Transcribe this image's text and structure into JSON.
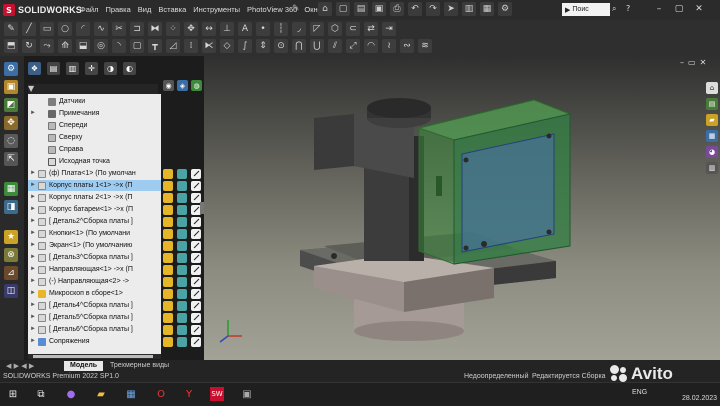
{
  "app": {
    "logo_text": "SOLIDWORKS",
    "logo_letter": "S"
  },
  "menu": [
    "Файл",
    "Правка",
    "Вид",
    "Вставка",
    "Инструменты",
    "PhotoView 360",
    "Окно"
  ],
  "search": {
    "value": "Поис"
  },
  "tree": [
    {
      "label": "Датчики",
      "icon": "sensor-icon",
      "expander": ""
    },
    {
      "label": "Примечания",
      "icon": "annotations-icon",
      "expander": "►"
    },
    {
      "label": "Спереди",
      "icon": "plane-icon",
      "expander": ""
    },
    {
      "label": "Сверху",
      "icon": "plane-icon",
      "expander": ""
    },
    {
      "label": "Справа",
      "icon": "plane-icon",
      "expander": ""
    },
    {
      "label": "Исходная точка",
      "icon": "origin-icon",
      "expander": ""
    },
    {
      "label": "(ф) Плата<1> (По умолчан",
      "icon": "part-icon",
      "expander": "►"
    },
    {
      "label": "Корпус платы 1<1> ->x (П",
      "icon": "part-icon",
      "expander": "►",
      "selected": true
    },
    {
      "label": "Корпус платы 2<1> ->x (П",
      "icon": "part-icon",
      "expander": "►"
    },
    {
      "label": "Корпус батареи<1> ->x (П",
      "icon": "part-icon",
      "expander": "►"
    },
    {
      "label": "[ Деталь2^Сборка платы ]",
      "icon": "part-icon",
      "expander": "►"
    },
    {
      "label": "Кнопки<1> (По умолчани",
      "icon": "part-icon",
      "expander": "►"
    },
    {
      "label": "Экран<1> (По умолчанию",
      "icon": "part-icon",
      "expander": "►"
    },
    {
      "label": "[ Деталь3^Сборка платы ]",
      "icon": "part-icon",
      "expander": "►"
    },
    {
      "label": "Направляющая<1> ->x (П",
      "icon": "part-icon",
      "expander": "►"
    },
    {
      "label": "(-) Направляющая<2> ->",
      "icon": "part-icon",
      "expander": "►"
    },
    {
      "label": "Микроскоп в сборе<1>",
      "icon": "assembly-icon",
      "expander": "►"
    },
    {
      "label": "[ Деталь4^Сборка платы ]",
      "icon": "part-icon",
      "expander": "►"
    },
    {
      "label": "[ Деталь5^Сборка платы ]",
      "icon": "part-icon",
      "expander": "►"
    },
    {
      "label": "[ Деталь6^Сборка платы ]",
      "icon": "part-icon",
      "expander": "►"
    },
    {
      "label": "Сопряжения",
      "icon": "mates-icon",
      "expander": "►"
    }
  ],
  "tabs": {
    "model": "Модель",
    "views_3d": "Трехмерные виды"
  },
  "status": {
    "product": "SOLIDWORKS Premium 2022 SP1.0",
    "state": "Недоопределенный",
    "mode": "Редактируется Сборка"
  },
  "taskbar": {
    "lang": "ENG",
    "date": "28.02.2023"
  },
  "watermark": {
    "text": "Avito"
  },
  "colors": {
    "accent": "#c8102e",
    "selection": "#9ecbf0",
    "transparent_housing": "#3c8a3c"
  }
}
